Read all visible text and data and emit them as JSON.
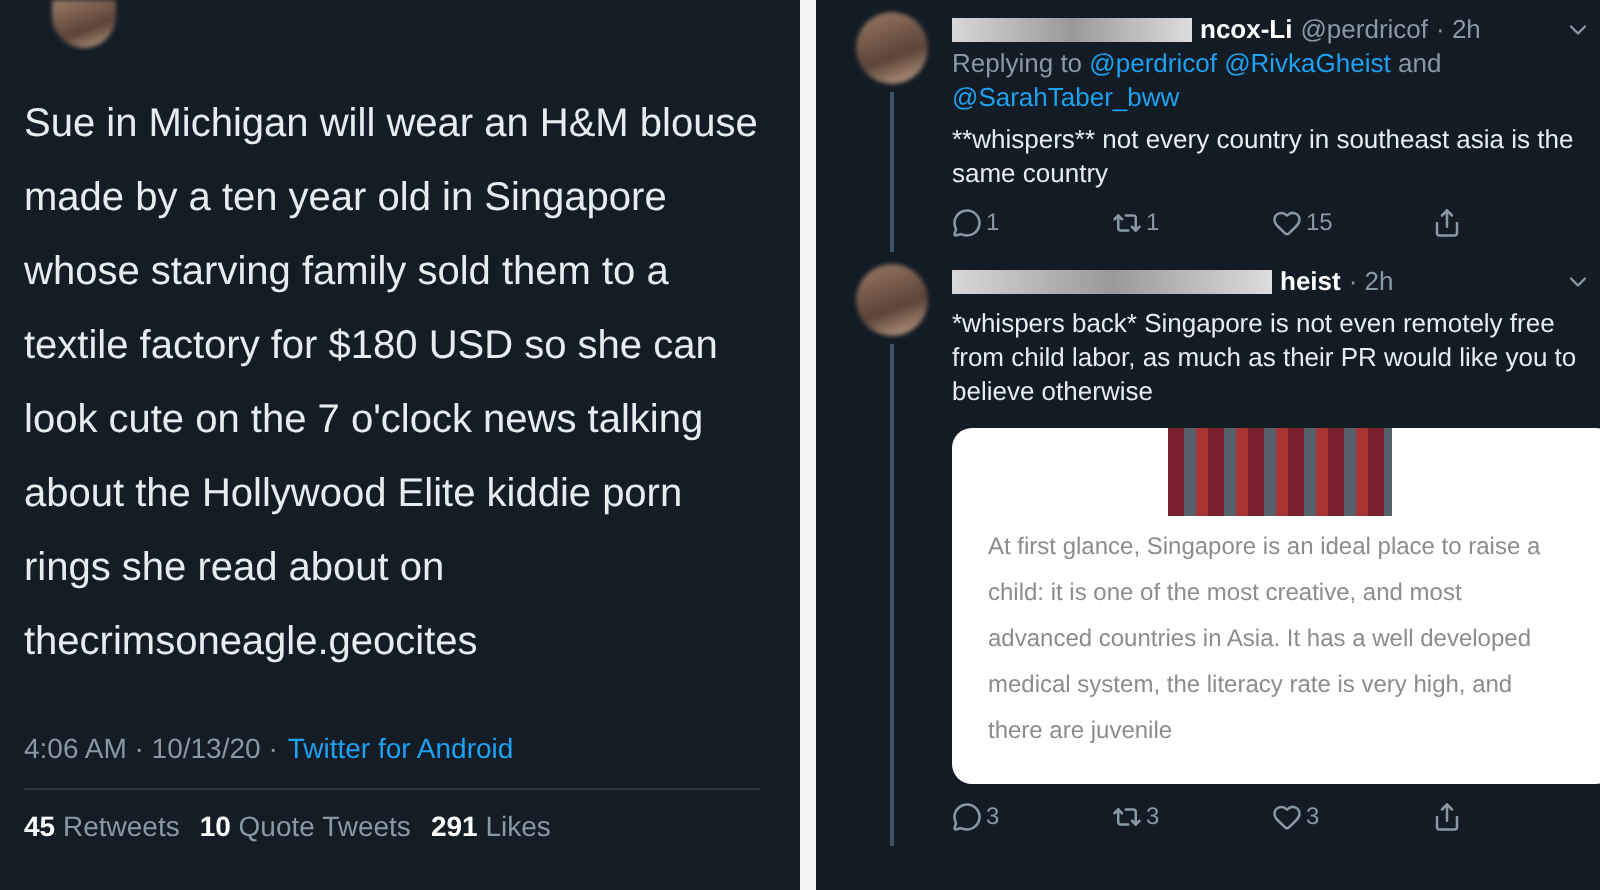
{
  "main_tweet": {
    "text": "Sue in Michigan will wear an H&M blouse made by a ten year old in Singapore whose starving family sold them to a textile factory for $180 USD so she can look cute on the 7 o'clock news talking about the Hollywood Elite kiddie porn rings she read about on thecrimsoneagle.geocites",
    "time": "4:06 AM · 10/13/20 ·",
    "source": "Twitter for Android",
    "stats": [
      {
        "count": "45",
        "label": "Retweets"
      },
      {
        "count": "10",
        "label": "Quote Tweets"
      },
      {
        "count": "291",
        "label": "Likes"
      }
    ]
  },
  "replies": [
    {
      "name": "ncox-Li",
      "handle": "@perdricof",
      "time": "· 2h",
      "reply_to": {
        "label": "Replying to",
        "mentions": [
          "@perdricof",
          "@RivkaGheist",
          "@SarahTaber_bww"
        ],
        "conjunction": "and"
      },
      "text": "**whispers** not every country in southeast asia is the same country",
      "actions": [
        {
          "kind": "reply",
          "count": "1"
        },
        {
          "kind": "retweet",
          "count": "1"
        },
        {
          "kind": "like",
          "count": "15"
        },
        {
          "kind": "share"
        }
      ]
    },
    {
      "name": "heist",
      "time": "· 2h",
      "text": "*whispers back* Singapore is not even remotely free from child labor, as much as their PR would like you to believe otherwise",
      "card": {
        "text": "At first glance, Singapore is an ideal place to raise a child: it is one of the most creative, and most advanced countries in Asia. It has a well developed medical system, the literacy rate is very high, and there are juvenile"
      },
      "actions": [
        {
          "kind": "reply",
          "count": "3"
        },
        {
          "kind": "retweet",
          "count": "3"
        },
        {
          "kind": "like",
          "count": "3"
        },
        {
          "kind": "share"
        }
      ]
    }
  ]
}
